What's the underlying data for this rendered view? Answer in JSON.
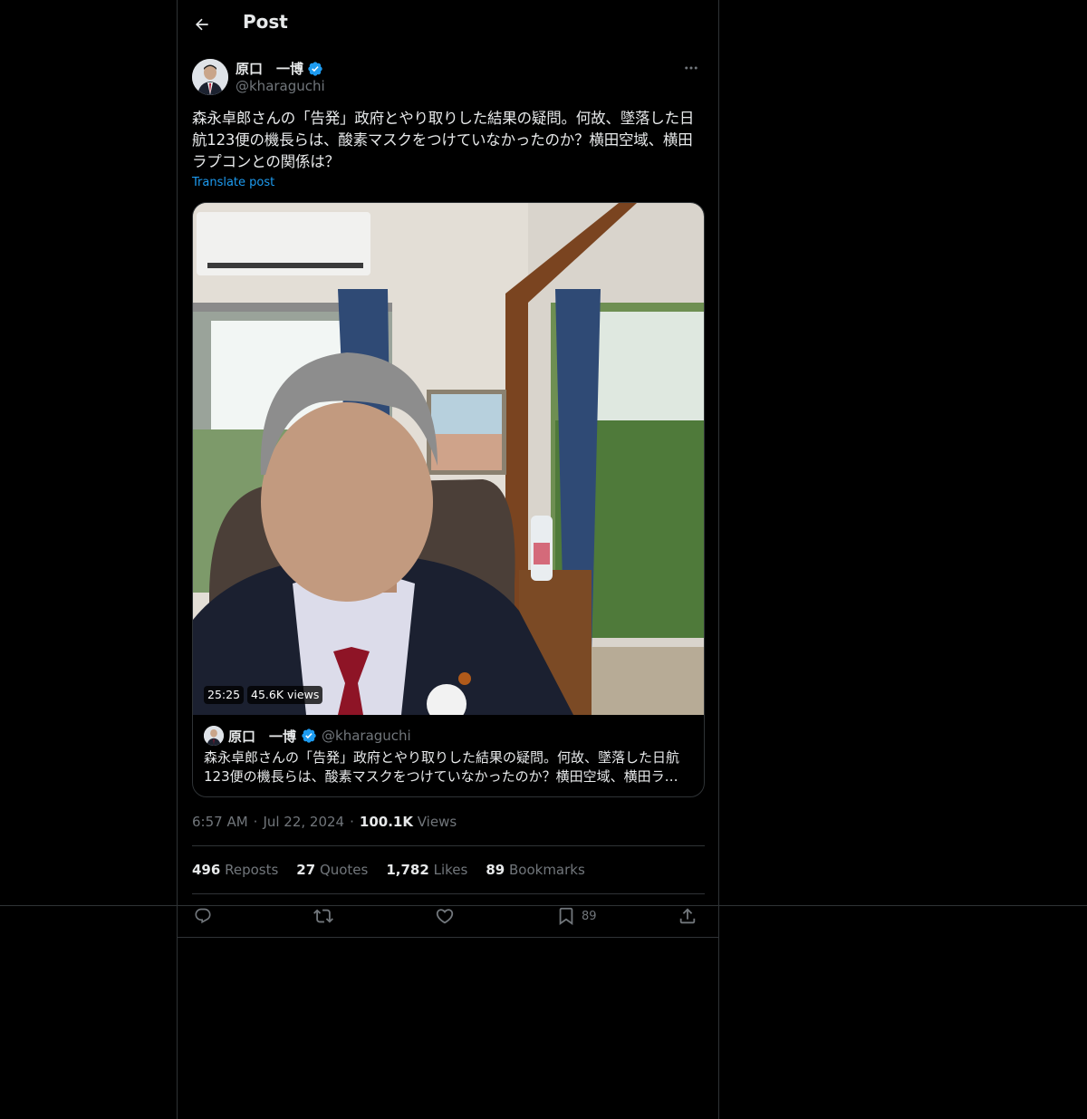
{
  "header": {
    "title": "Post"
  },
  "post": {
    "author_name": "原口　一博",
    "author_handle": "@kharaguchi",
    "text": "森永卓郎さんの「告発」政府とやり取りした結果の疑問。何故、墜落した日航123便の機長らは、酸素マスクをつけていなかったのか？横田空域、横田ラプコンとの関係は？",
    "translate_label": "Translate post",
    "video": {
      "duration": "25:25",
      "views": "45.6K views"
    },
    "quote": {
      "author_name": "原口　一博",
      "author_handle": "@kharaguchi",
      "text": "森永卓郎さんの「告発」政府とやり取りした結果の疑問。何故、墜落した日航123便の機長らは、酸素マスクをつけていなかったのか？横田空域、横田ラプコンとの関係は？"
    },
    "time": "6:57 AM",
    "date": "Jul 22, 2024",
    "views_count": "100.1K",
    "views_label": "Views",
    "separator": "·"
  },
  "stats": [
    {
      "count": "496",
      "label": "Reposts"
    },
    {
      "count": "27",
      "label": "Quotes"
    },
    {
      "count": "1,782",
      "label": "Likes"
    },
    {
      "count": "89",
      "label": "Bookmarks"
    }
  ],
  "actions": {
    "bookmark_count": "89"
  },
  "colors": {
    "accent": "#1d9bf0",
    "verified": "#1d9bf0",
    "background": "#000000",
    "border": "#2f3336",
    "muted": "#71767b"
  },
  "icons": [
    "back-arrow-icon",
    "verified-badge-icon",
    "more-icon",
    "reply-icon",
    "repost-icon",
    "like-icon",
    "bookmark-icon",
    "share-icon"
  ]
}
